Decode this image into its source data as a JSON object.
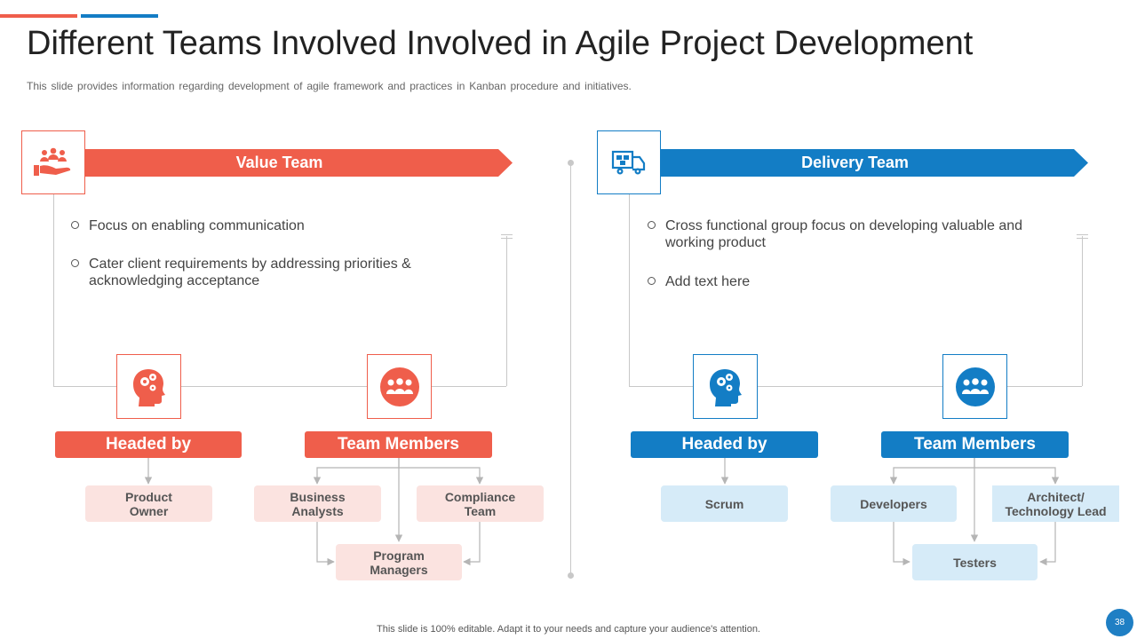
{
  "header": {
    "title": "Different Teams Involved Involved in Agile Project Development",
    "subtitle": "This slide provides information regarding development of agile framework and practices in Kanban procedure and initiatives."
  },
  "colors": {
    "red": "#ef5e4b",
    "blue": "#137dc5"
  },
  "value_team": {
    "title": "Value Team",
    "icon": "hand-holding-people-icon",
    "bullets": [
      "Focus on enabling communication",
      "Cater client requirements by addressing priorities & acknowledging acceptance"
    ],
    "headed_by": {
      "label": "Headed by",
      "icon": "head-gears-icon",
      "members": [
        "Product Owner"
      ]
    },
    "team_members": {
      "label": "Team Members",
      "icon": "group-people-icon",
      "members": [
        "Business Analysts",
        "Compliance Team",
        "Program Managers"
      ]
    }
  },
  "delivery_team": {
    "title": "Delivery Team",
    "icon": "delivery-truck-icon",
    "bullets": [
      "Cross functional group focus on developing valuable and working product",
      "Add text here"
    ],
    "headed_by": {
      "label": "Headed by",
      "icon": "head-gears-icon",
      "members": [
        "Scrum"
      ]
    },
    "team_members": {
      "label": "Team Members",
      "icon": "group-people-icon",
      "members": [
        "Developers",
        "Architect/ Technology Lead",
        "Testers"
      ]
    }
  },
  "footer": {
    "note": "This slide is 100% editable. Adapt it to your needs and capture your audience's attention.",
    "page_number": "38"
  }
}
